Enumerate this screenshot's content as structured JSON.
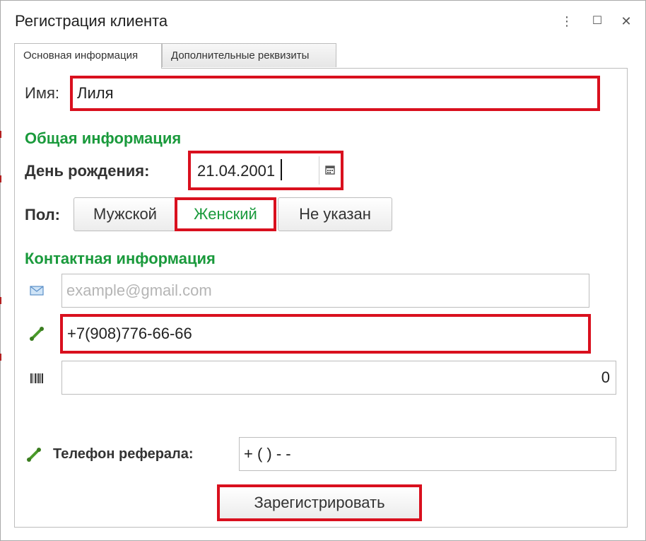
{
  "window": {
    "title": "Регистрация клиента",
    "menu_icon": "⋮",
    "maximize_icon": "☐",
    "close_icon": "✕"
  },
  "tabs": [
    {
      "label": "Основная информация",
      "active": true
    },
    {
      "label": "Дополнительные реквизиты",
      "active": false
    }
  ],
  "form": {
    "name_label": "Имя:",
    "name_value": "Лиля",
    "general_section": "Общая информация",
    "birthday_label": "День рождения:",
    "birthday_value": "21.04.2001",
    "gender_label": "Пол:",
    "gender_options": [
      "Мужской",
      "Женский",
      "Не указан"
    ],
    "gender_selected": "Женский",
    "contact_section": "Контактная информация",
    "email_placeholder": "example@gmail.com",
    "phone_value": "+7(908)776-66-66",
    "barcode_value": "0",
    "referral_label": "Телефон реферала:",
    "referral_value": "+ (   )   -  -",
    "register_button": "Зарегистрировать"
  },
  "icons": {
    "calendar": "calendar-icon",
    "email": "envelope-icon",
    "phone": "phone-icon",
    "barcode": "barcode-icon"
  },
  "colors": {
    "section_green": "#1a9a3c",
    "highlight_red": "#d9101e",
    "border_gray": "#bdbdbd"
  }
}
